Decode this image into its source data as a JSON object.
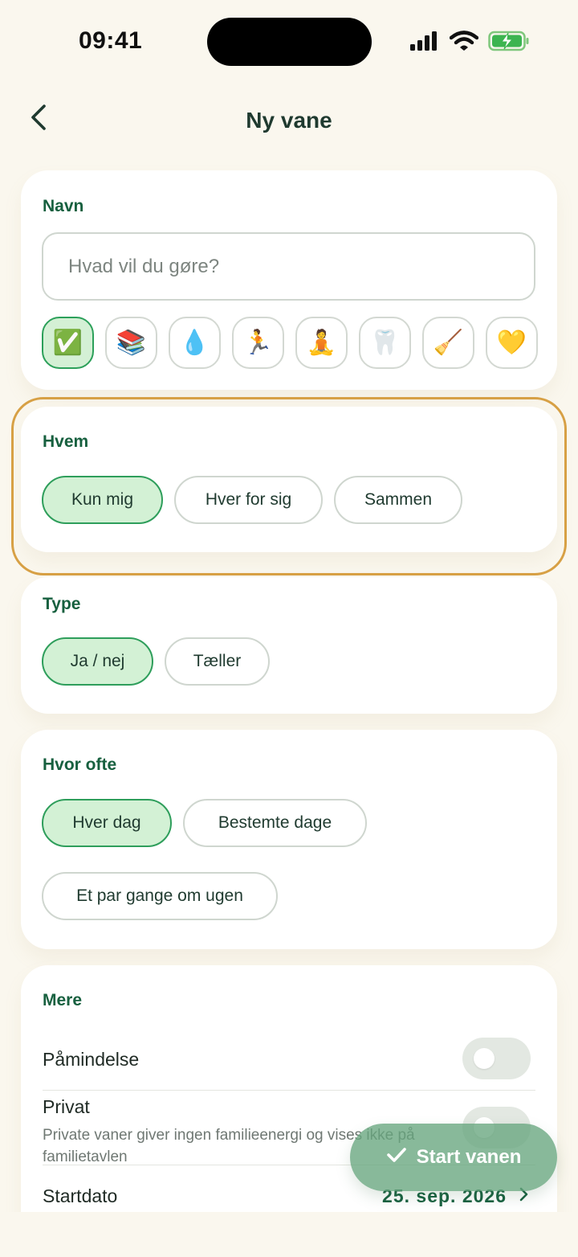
{
  "status_bar": {
    "time": "09:41"
  },
  "nav": {
    "title": "Ny vane"
  },
  "name_card": {
    "label": "Navn",
    "placeholder": "Hvad vil du gøre?",
    "value": "",
    "emojis": [
      "✅",
      "📚",
      "💧",
      "🏃",
      "🧘",
      "🦷",
      "🧹",
      "💛"
    ],
    "selected_emoji_index": 0
  },
  "who_card": {
    "label": "Hvem",
    "options": [
      "Kun mig",
      "Hver for sig",
      "Sammen"
    ],
    "selected_index": 0
  },
  "type_card": {
    "label": "Type",
    "options": [
      "Ja / nej",
      "Tæller"
    ],
    "selected_index": 0
  },
  "frequency_card": {
    "label": "Hvor ofte",
    "options": [
      "Hver dag",
      "Bestemte dage",
      "Et par gange om ugen"
    ],
    "selected_index": 0
  },
  "more_card": {
    "label": "Mere",
    "reminder_label": "Påmindelse",
    "reminder_on": false,
    "private_label": "Privat",
    "private_help": "Private vaner giver ingen familieenergi og vises ikke på familietavlen",
    "private_on": false,
    "start_date_label": "Startdato",
    "start_date_value": "25. sep. 2026"
  },
  "primary_action": {
    "label": "Start vanen"
  },
  "colors": {
    "accent": "#17603f",
    "selected_fill": "#d3f1d5",
    "highlight": "#d7a045",
    "background": "#faf7ee"
  }
}
